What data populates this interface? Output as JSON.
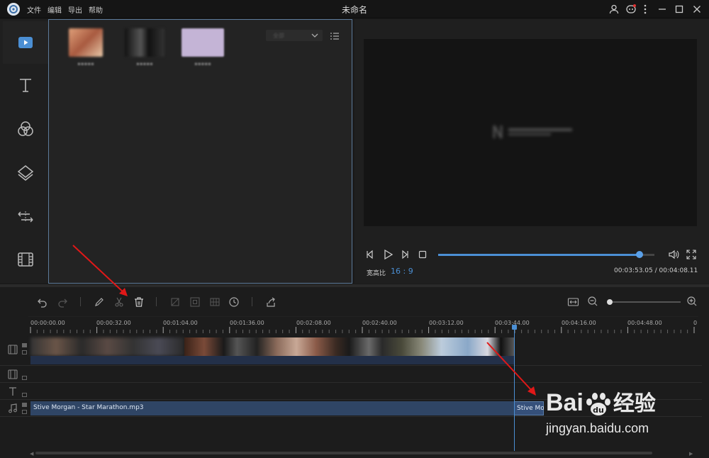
{
  "titlebar": {
    "menu": [
      "文件",
      "编辑",
      "导出",
      "帮助"
    ],
    "title": "未命名"
  },
  "library": {
    "tab_label": "导入",
    "sort_label": "全部",
    "thumb_colors": [
      "#c9866a",
      "#222222",
      "#c8b8d8"
    ]
  },
  "preview": {
    "aspect_label": "宽高比",
    "aspect_value": "16 : 9",
    "time_current": "00:03:53.05",
    "time_separator": " / ",
    "time_total": "00:04:08.11",
    "progress_fraction": 0.93
  },
  "timeline": {
    "ruler": [
      "00:00:00.00",
      "00:00:32.00",
      "00:01:04.00",
      "00:01:36.00",
      "00:02:08.00",
      "00:02:40.00",
      "00:03:12.00",
      "00:03:44.00",
      "00:04:16.00",
      "00:04:48.00",
      "0"
    ],
    "audio_clip_label": "Stive Morgan - Star Marathon.mp3",
    "audio_clip2_label": "Stive Mo",
    "zoom_fraction": 0.0
  },
  "watermark": {
    "brand_prefix": "Bai",
    "brand_suffix": "经验",
    "url": "jingyan.baidu.com"
  },
  "colors": {
    "accent": "#4b8fd4",
    "annotation": "#e01818"
  }
}
